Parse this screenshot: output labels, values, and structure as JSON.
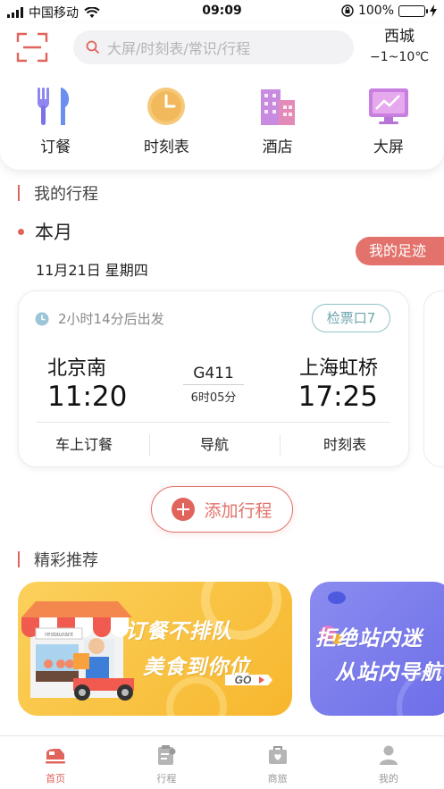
{
  "status_bar": {
    "carrier": "中国移动",
    "time": "09:09",
    "battery": "100%",
    "battery_level": 1.0
  },
  "header": {
    "search_placeholder": "大屏/时刻表/常识/行程",
    "weather": {
      "city": "西城",
      "temp": "−1~10℃"
    }
  },
  "quick_links": [
    {
      "label": "订餐",
      "icon": "cutlery-icon"
    },
    {
      "label": "时刻表",
      "icon": "clock-icon"
    },
    {
      "label": "酒店",
      "icon": "hotel-icon"
    },
    {
      "label": "大屏",
      "icon": "monitor-icon"
    }
  ],
  "my_trips": {
    "title": "我的行程",
    "month": "本月",
    "date": "11月21日 星期四",
    "footprint_button": "我的足迹",
    "trip": {
      "depart_in": "2小时14分后出发",
      "gate": "检票口7",
      "from_station": "北京南",
      "from_time": "11:20",
      "train_no": "G411",
      "duration": "6时05分",
      "to_station": "上海虹桥",
      "to_time": "17:25",
      "actions": [
        "车上订餐",
        "导航",
        "时刻表"
      ]
    },
    "add_button": "添加行程"
  },
  "recommend": {
    "title": "精彩推荐",
    "banner1": {
      "line1": "订餐不排队",
      "line2": "美食到你位",
      "badge": "GO",
      "shop_sign": "restaurant"
    },
    "banner2": {
      "line1": "拒绝站内迷",
      "line2": "从站内导航"
    }
  },
  "tabs": [
    {
      "label": "首页",
      "active": true,
      "icon": "train-icon"
    },
    {
      "label": "行程",
      "active": false,
      "icon": "itinerary-icon"
    },
    {
      "label": "商旅",
      "active": false,
      "icon": "suitcase-icon"
    },
    {
      "label": "我的",
      "active": false,
      "icon": "user-icon"
    }
  ],
  "colors": {
    "accent": "#e0645c",
    "gate": "#6fa6ae",
    "banner_yellow": "#f9c43f",
    "banner_purple": "#7b7cec"
  }
}
